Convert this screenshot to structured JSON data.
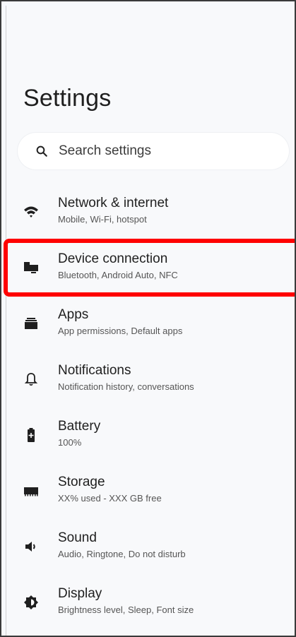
{
  "header": {
    "title": "Settings"
  },
  "search": {
    "placeholder": "Search settings",
    "icon": "search-icon"
  },
  "items": [
    {
      "key": "network",
      "title": "Network & internet",
      "subtitle": "Mobile, Wi-Fi, hotspot",
      "icon": "wifi-icon"
    },
    {
      "key": "device",
      "title": "Device connection",
      "subtitle": "Bluetooth, Android Auto, NFC",
      "icon": "devices-icon",
      "highlighted": true
    },
    {
      "key": "apps",
      "title": "Apps",
      "subtitle": "App permissions, Default apps",
      "icon": "apps-icon"
    },
    {
      "key": "notifications",
      "title": "Notifications",
      "subtitle": "Notification history, conversations",
      "icon": "bell-icon"
    },
    {
      "key": "battery",
      "title": "Battery",
      "subtitle": "100%",
      "icon": "battery-icon"
    },
    {
      "key": "storage",
      "title": "Storage",
      "subtitle": "XX% used - XXX GB free",
      "icon": "storage-icon"
    },
    {
      "key": "sound",
      "title": "Sound",
      "subtitle": "Audio, Ringtone, Do not disturb",
      "icon": "speaker-icon"
    },
    {
      "key": "display",
      "title": "Display",
      "subtitle": "Brightness level, Sleep, Font size",
      "icon": "brightness-icon"
    }
  ],
  "colors": {
    "highlight": "#ff0000",
    "background": "#f8f9fb",
    "text_primary": "#1f1f1f",
    "text_secondary": "#555555"
  }
}
